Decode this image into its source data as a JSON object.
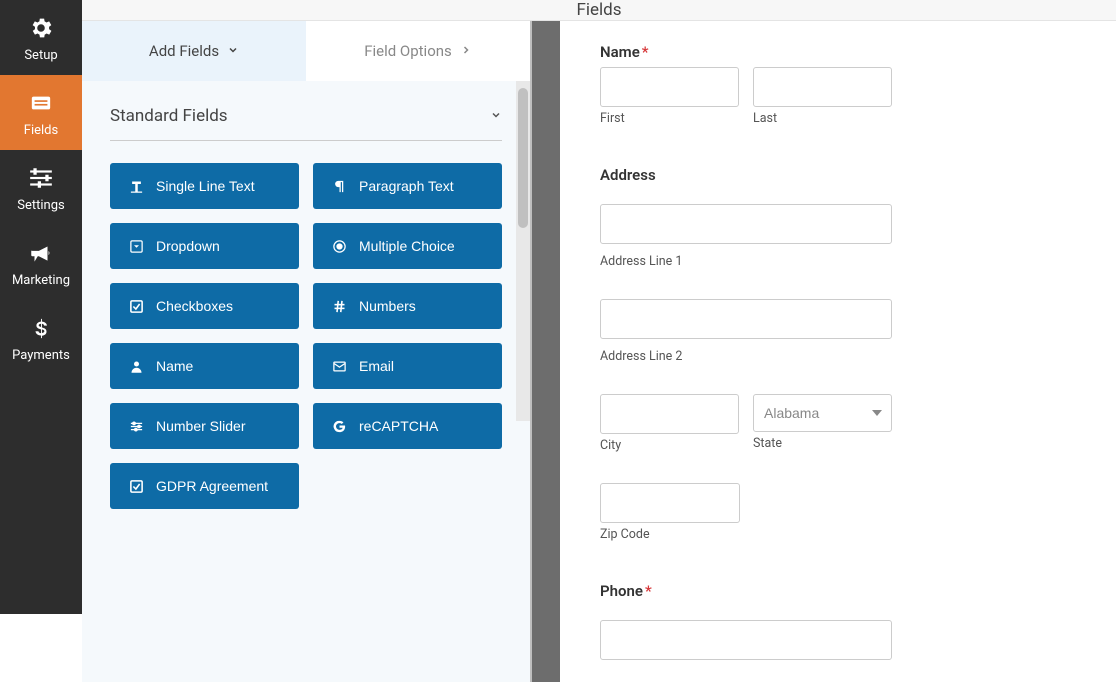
{
  "header": {
    "title": "Fields"
  },
  "sidebar": {
    "items": [
      {
        "label": "Setup",
        "icon": "gear-icon"
      },
      {
        "label": "Fields",
        "icon": "list-icon",
        "active": true
      },
      {
        "label": "Settings",
        "icon": "sliders-icon"
      },
      {
        "label": "Marketing",
        "icon": "bullhorn-icon"
      },
      {
        "label": "Payments",
        "icon": "dollar-icon"
      }
    ]
  },
  "tabs": {
    "add_fields": "Add Fields",
    "field_options": "Field Options"
  },
  "group": {
    "title": "Standard Fields",
    "fields": [
      {
        "label": "Single Line Text",
        "icon": "text-icon"
      },
      {
        "label": "Paragraph Text",
        "icon": "paragraph-icon"
      },
      {
        "label": "Dropdown",
        "icon": "caret-square-icon"
      },
      {
        "label": "Multiple Choice",
        "icon": "radio-icon"
      },
      {
        "label": "Checkboxes",
        "icon": "checkbox-icon"
      },
      {
        "label": "Numbers",
        "icon": "hash-icon"
      },
      {
        "label": "Name",
        "icon": "user-icon"
      },
      {
        "label": "Email",
        "icon": "envelope-icon"
      },
      {
        "label": "Number Slider",
        "icon": "sliders-h-icon"
      },
      {
        "label": "reCAPTCHA",
        "icon": "google-icon"
      },
      {
        "label": "GDPR Agreement",
        "icon": "check-square-icon"
      }
    ]
  },
  "preview": {
    "name": {
      "label": "Name",
      "required": true,
      "first_sub": "First",
      "last_sub": "Last"
    },
    "address": {
      "label": "Address",
      "line1_sub": "Address Line 1",
      "line2_sub": "Address Line 2",
      "city_sub": "City",
      "state_sub": "State",
      "zip_sub": "Zip Code",
      "state_value": "Alabama"
    },
    "phone": {
      "label": "Phone",
      "required": true
    }
  }
}
